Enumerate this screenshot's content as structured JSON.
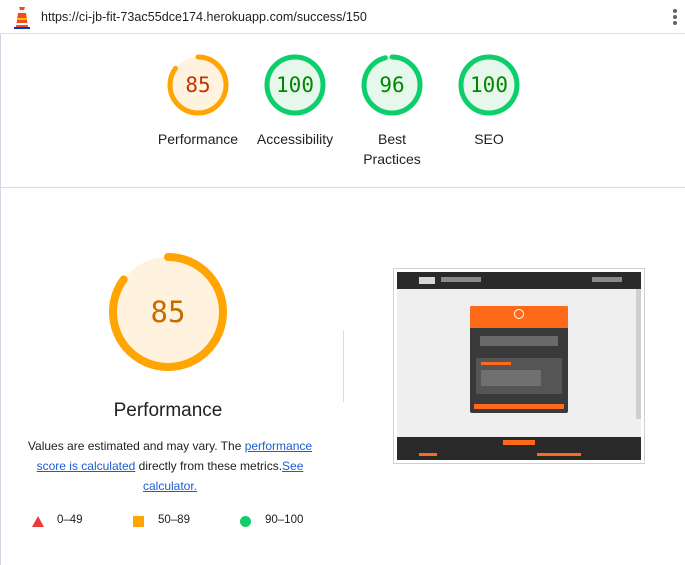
{
  "browser": {
    "url": "https://ci-jb-fit-73ac55dce174.herokuapp.com/success/150",
    "site_icon": "lighthouse-icon",
    "menu_icon": "kebab-menu-icon"
  },
  "summary": {
    "scores": [
      {
        "label": "Performance",
        "score": 85,
        "status": "average"
      },
      {
        "label": "Accessibility",
        "score": 100,
        "status": "pass"
      },
      {
        "label_line1": "Best",
        "label_line2": "Practices",
        "score": 96,
        "status": "pass"
      },
      {
        "label": "SEO",
        "score": 100,
        "status": "pass"
      }
    ]
  },
  "detail": {
    "score": 85,
    "title": "Performance",
    "desc_prefix": "Values are estimated and may vary. The ",
    "desc_link1_part1": "performance",
    "desc_link1_part2": "score is calculated",
    "desc_middle": " directly from these metrics.",
    "desc_link2_part1": "See",
    "desc_link2_part2": "calculator."
  },
  "legend": [
    {
      "range": "0–49",
      "shape": "triangle",
      "color": "#eb3b3b"
    },
    {
      "range": "50–89",
      "shape": "square",
      "color": "#ffa400"
    },
    {
      "range": "90–100",
      "shape": "circle",
      "color": "#0cce6b"
    }
  ],
  "colors": {
    "average": "#ffa400",
    "average_text": "#c33300",
    "average_bg": "#fff3e0",
    "pass": "#0cce6b",
    "pass_text": "#008800",
    "pass_bg": "#e6f7ec",
    "link": "#1a5fd1"
  }
}
